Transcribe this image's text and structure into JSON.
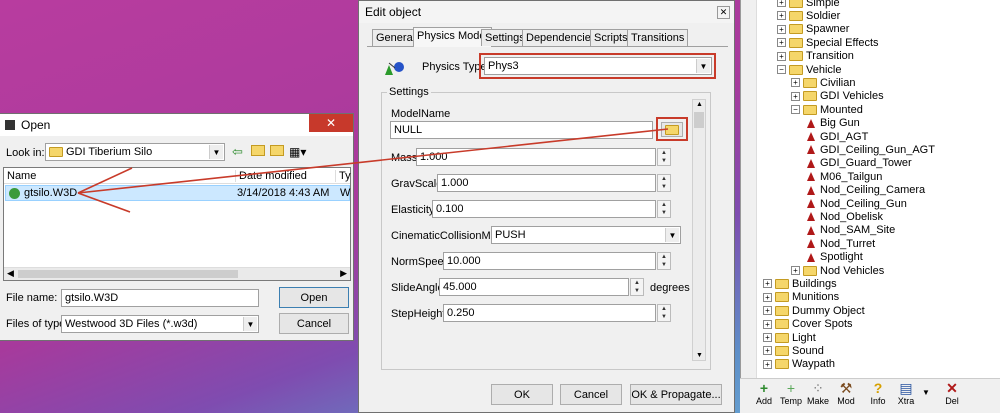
{
  "open_dialog": {
    "title": "Open",
    "look_in_label": "Look in:",
    "look_in_value": "GDI Tiberium Silo",
    "columns": [
      "Name",
      "Date modified",
      "Ty"
    ],
    "file": {
      "name": "gtsilo.W3D",
      "date": "3/14/2018 4:43 AM",
      "type": "W"
    },
    "file_name_label": "File name:",
    "file_name_value": "gtsilo.W3D",
    "file_type_label": "Files of type:",
    "file_type_value": "Westwood 3D Files (*.w3d)",
    "open_button": "Open",
    "cancel_button": "Cancel"
  },
  "edit_dialog": {
    "title": "Edit object",
    "tabs": [
      "General",
      "Physics Model",
      "Settings",
      "Dependencies",
      "Scripts",
      "Transitions"
    ],
    "physics_type_label": "Physics Type:",
    "physics_type_value": "Phys3",
    "group_label": "Settings",
    "model_name_label": "ModelName",
    "model_name_value": "NULL",
    "fields": {
      "mass": {
        "label": "Mass",
        "value": "1.000"
      },
      "gravscale": {
        "label": "GravScale",
        "value": "1.000"
      },
      "elasticity": {
        "label": "Elasticity",
        "value": "0.100"
      },
      "cinematic": {
        "label": "CinematicCollisionMode",
        "value": "PUSH"
      },
      "normspeed": {
        "label": "NormSpeed",
        "value": "10.000"
      },
      "slideangle": {
        "label": "SlideAngle",
        "value": "45.000",
        "unit": "degrees"
      },
      "stepheight": {
        "label": "StepHeight",
        "value": "0.250"
      }
    },
    "ok_button": "OK",
    "cancel_button": "Cancel",
    "ok_propagate_button": "OK & Propagate..."
  },
  "tree": {
    "items": [
      {
        "label": "Simple"
      },
      {
        "label": "Soldier"
      },
      {
        "label": "Spawner"
      },
      {
        "label": "Special Effects"
      },
      {
        "label": "Transition"
      },
      {
        "label": "Vehicle"
      },
      {
        "label": "Civilian"
      },
      {
        "label": "GDI Vehicles"
      },
      {
        "label": "Mounted"
      },
      {
        "label": "Big Gun"
      },
      {
        "label": "GDI_AGT"
      },
      {
        "label": "GDI_Ceiling_Gun_AGT"
      },
      {
        "label": "GDI_Guard_Tower"
      },
      {
        "label": "M06_Tailgun"
      },
      {
        "label": "Nod_Ceiling_Camera"
      },
      {
        "label": "Nod_Ceiling_Gun"
      },
      {
        "label": "Nod_Obelisk"
      },
      {
        "label": "Nod_SAM_Site"
      },
      {
        "label": "Nod_Turret"
      },
      {
        "label": "Spotlight"
      },
      {
        "label": "Nod Vehicles"
      },
      {
        "label": "Buildings"
      },
      {
        "label": "Munitions"
      },
      {
        "label": "Dummy Object"
      },
      {
        "label": "Cover Spots"
      },
      {
        "label": "Light"
      },
      {
        "label": "Sound"
      },
      {
        "label": "Waypath"
      }
    ]
  },
  "toolbar": {
    "add": "Add",
    "temp": "Temp",
    "make": "Make",
    "mod": "Mod",
    "info": "Info",
    "xtra": "Xtra",
    "del": "Del"
  }
}
